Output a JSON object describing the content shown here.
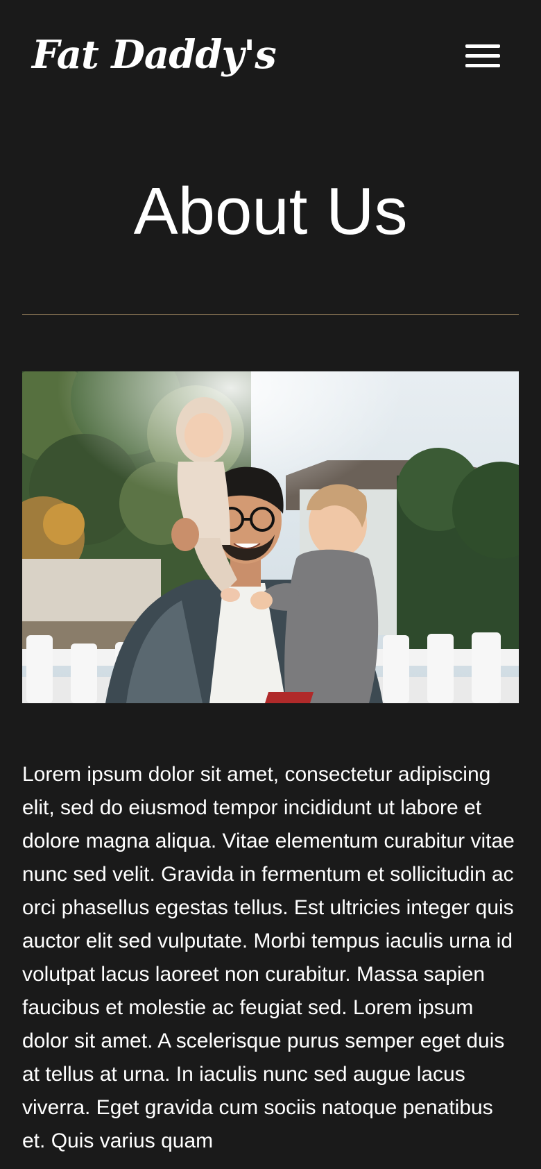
{
  "header": {
    "logo_text": "Fat Daddy's",
    "menu_icon": "hamburger-menu-icon"
  },
  "page": {
    "title": "About Us"
  },
  "colors": {
    "background": "#1a1a1a",
    "text": "#ffffff",
    "divider": "#b89b6e"
  },
  "hero": {
    "image_subject": "father carrying two young children outdoors in front of a white picket fence"
  },
  "about": {
    "body": "Lorem ipsum dolor sit amet, consectetur adipiscing elit, sed do eiusmod tempor incididunt ut labore et dolore magna aliqua. Vitae elementum curabitur vitae nunc sed velit. Gravida in fermentum et sollicitudin ac orci phasellus egestas tellus. Est ultricies integer quis auctor elit sed vulputate. Morbi tempus iaculis urna id volutpat lacus laoreet non curabitur. Massa sapien faucibus et molestie ac feugiat sed. Lorem ipsum dolor sit amet. A scelerisque purus semper eget duis at tellus at urna. In iaculis nunc sed augue lacus viverra. Eget gravida cum sociis natoque penatibus et. Quis varius quam"
  }
}
